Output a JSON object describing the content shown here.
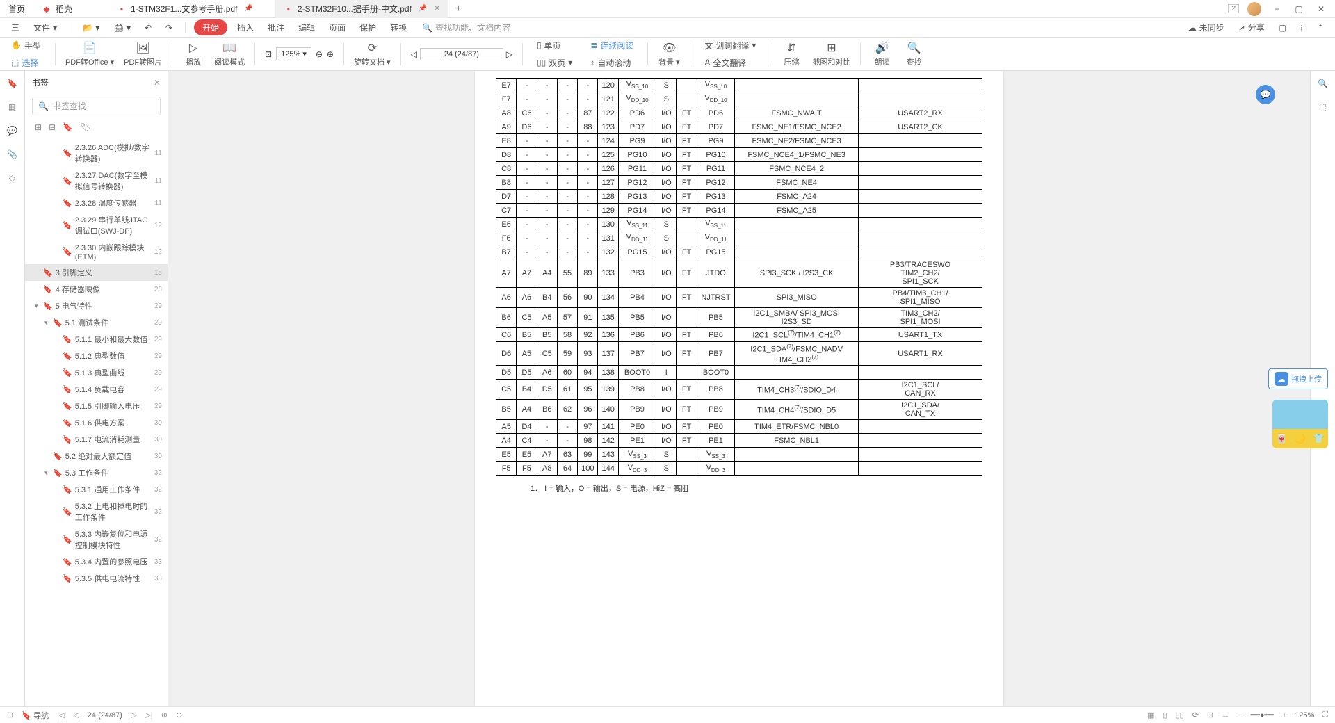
{
  "tabs": {
    "home": "首页",
    "daoke": "稻壳",
    "file1": "1-STM32F1...文参考手册.pdf",
    "file2": "2-STM32F10...据手册-中文.pdf"
  },
  "win": {
    "badge": "2"
  },
  "menubar": {
    "menu": "三",
    "file": "文件",
    "start": "开始",
    "insert": "插入",
    "annotate": "批注",
    "edit": "编辑",
    "page": "页面",
    "protect": "保护",
    "convert": "转换",
    "search_placeholder": "查找功能、文档内容",
    "unsynced": "未同步",
    "share": "分享"
  },
  "ribbon": {
    "hand": "手型",
    "select": "选择",
    "pdf_office": "PDF转Office",
    "pdf_image": "PDF转图片",
    "play": "播放",
    "read_mode": "阅读模式",
    "zoom": "125%",
    "rotate": "旋转文档",
    "page_nav": "24 (24/87)",
    "single": "单页",
    "double": "双页",
    "continuous": "连续阅读",
    "auto_scroll": "自动滚动",
    "background": "背景",
    "word_translate": "划词翻译",
    "full_translate": "全文翻译",
    "compress": "压缩",
    "crop_compare": "截图和对比",
    "read_aloud": "朗读",
    "search": "查找"
  },
  "sidebar": {
    "title": "书签",
    "search_placeholder": "书签查找",
    "items": [
      {
        "indent": 3,
        "text": "2.3.26 ADC(模拟/数字转换器)",
        "page": "11"
      },
      {
        "indent": 3,
        "text": "2.3.27 DAC(数字至模拟信号转换器)",
        "page": "11"
      },
      {
        "indent": 3,
        "text": "2.3.28 温度传感器",
        "page": "11"
      },
      {
        "indent": 3,
        "text": "2.3.29 串行单线JTAG调试口(SWJ-DP)",
        "page": "12"
      },
      {
        "indent": 3,
        "text": "2.3.30 内嵌跟踪模块(ETM)",
        "page": "12"
      },
      {
        "indent": 1,
        "text": "3 引脚定义",
        "page": "15",
        "selected": true
      },
      {
        "indent": 1,
        "text": "4 存储器映像",
        "page": "28"
      },
      {
        "indent": 1,
        "text": "5 电气特性",
        "page": "29",
        "expand": "▾"
      },
      {
        "indent": 2,
        "text": "5.1 测试条件",
        "page": "29",
        "expand": "▾"
      },
      {
        "indent": 3,
        "text": "5.1.1 最小和最大数值",
        "page": "29"
      },
      {
        "indent": 3,
        "text": "5.1.2 典型数值",
        "page": "29"
      },
      {
        "indent": 3,
        "text": "5.1.3 典型曲线",
        "page": "29"
      },
      {
        "indent": 3,
        "text": "5.1.4 负载电容",
        "page": "29"
      },
      {
        "indent": 3,
        "text": "5.1.5 引脚输入电压",
        "page": "29"
      },
      {
        "indent": 3,
        "text": "5.1.6 供电方案",
        "page": "30"
      },
      {
        "indent": 3,
        "text": "5.1.7 电流消耗测量",
        "page": "30"
      },
      {
        "indent": 2,
        "text": "5.2 绝对最大额定值",
        "page": "30"
      },
      {
        "indent": 2,
        "text": "5.3 工作条件",
        "page": "32",
        "expand": "▾"
      },
      {
        "indent": 3,
        "text": "5.3.1 通用工作条件",
        "page": "32"
      },
      {
        "indent": 3,
        "text": "5.3.2 上电和掉电时的工作条件",
        "page": "32"
      },
      {
        "indent": 3,
        "text": "5.3.3 内嵌复位和电源控制模块特性",
        "page": "32"
      },
      {
        "indent": 3,
        "text": "5.3.4 内置的参照电压",
        "page": "33"
      },
      {
        "indent": 3,
        "text": "5.3.5 供电电流特性",
        "page": "33"
      }
    ]
  },
  "doc_note": "1．  I = 输入，O = 输出，S = 电源，HiZ = 高阻",
  "table_rows": [
    [
      "E7",
      "-",
      "-",
      "-",
      "-",
      "120",
      "V<sub>SS_10</sub>",
      "S",
      "",
      "V<sub>SS_10</sub>",
      "",
      ""
    ],
    [
      "F7",
      "-",
      "-",
      "-",
      "-",
      "121",
      "V<sub>DD_10</sub>",
      "S",
      "",
      "V<sub>DD_10</sub>",
      "",
      ""
    ],
    [
      "A8",
      "C6",
      "-",
      "-",
      "87",
      "122",
      "PD6",
      "I/O",
      "FT",
      "PD6",
      "FSMC_NWAIT",
      "USART2_RX"
    ],
    [
      "A9",
      "D6",
      "-",
      "-",
      "88",
      "123",
      "PD7",
      "I/O",
      "FT",
      "PD7",
      "FSMC_NE1/FSMC_NCE2",
      "USART2_CK"
    ],
    [
      "E8",
      "-",
      "-",
      "-",
      "-",
      "124",
      "PG9",
      "I/O",
      "FT",
      "PG9",
      "FSMC_NE2/FSMC_NCE3",
      ""
    ],
    [
      "D8",
      "-",
      "-",
      "-",
      "-",
      "125",
      "PG10",
      "I/O",
      "FT",
      "PG10",
      "FSMC_NCE4_1/FSMC_NE3",
      ""
    ],
    [
      "C8",
      "-",
      "-",
      "-",
      "-",
      "126",
      "PG11",
      "I/O",
      "FT",
      "PG11",
      "FSMC_NCE4_2",
      ""
    ],
    [
      "B8",
      "-",
      "-",
      "-",
      "-",
      "127",
      "PG12",
      "I/O",
      "FT",
      "PG12",
      "FSMC_NE4",
      ""
    ],
    [
      "D7",
      "-",
      "-",
      "-",
      "-",
      "128",
      "PG13",
      "I/O",
      "FT",
      "PG13",
      "FSMC_A24",
      ""
    ],
    [
      "C7",
      "-",
      "-",
      "-",
      "-",
      "129",
      "PG14",
      "I/O",
      "FT",
      "PG14",
      "FSMC_A25",
      ""
    ],
    [
      "E6",
      "-",
      "-",
      "-",
      "-",
      "130",
      "V<sub>SS_11</sub>",
      "S",
      "",
      "V<sub>SS_11</sub>",
      "",
      ""
    ],
    [
      "F6",
      "-",
      "-",
      "-",
      "-",
      "131",
      "V<sub>DD_11</sub>",
      "S",
      "",
      "V<sub>DD_11</sub>",
      "",
      ""
    ],
    [
      "B7",
      "-",
      "-",
      "-",
      "-",
      "132",
      "PG15",
      "I/O",
      "FT",
      "PG15",
      "",
      ""
    ],
    [
      "A7",
      "A7",
      "A4",
      "55",
      "89",
      "133",
      "PB3",
      "I/O",
      "FT",
      "JTDO",
      "SPI3_SCK / I2S3_CK",
      "PB3/TRACESWO<br>TIM2_CH2/<br>SPI1_SCK"
    ],
    [
      "A6",
      "A6",
      "B4",
      "56",
      "90",
      "134",
      "PB4",
      "I/O",
      "FT",
      "NJTRST",
      "SPI3_MISO",
      "PB4/TIM3_CH1/<br>SPI1_MISO"
    ],
    [
      "B6",
      "C5",
      "A5",
      "57",
      "91",
      "135",
      "PB5",
      "I/O",
      "",
      "PB5",
      "I2C1_SMBA/ SPI3_MOSI<br>I2S3_SD",
      "TIM3_CH2/<br>SPI1_MOSI"
    ],
    [
      "C6",
      "B5",
      "B5",
      "58",
      "92",
      "136",
      "PB6",
      "I/O",
      "FT",
      "PB6",
      "I2C1_SCL<sup>(7)</sup>/TIM4_CH1<sup>(7)</sup>",
      "USART1_TX"
    ],
    [
      "D6",
      "A5",
      "C5",
      "59",
      "93",
      "137",
      "PB7",
      "I/O",
      "FT",
      "PB7",
      "I2C1_SDA<sup>(7)</sup>/FSMC_NADV<br>TIM4_CH2<sup>(7)</sup>",
      "USART1_RX"
    ],
    [
      "D5",
      "D5",
      "A6",
      "60",
      "94",
      "138",
      "BOOT0",
      "I",
      "",
      "BOOT0",
      "",
      ""
    ],
    [
      "C5",
      "B4",
      "D5",
      "61",
      "95",
      "139",
      "PB8",
      "I/O",
      "FT",
      "PB8",
      "TIM4_CH3<sup>(7)</sup>/SDIO_D4",
      "I2C1_SCL/<br>CAN_RX"
    ],
    [
      "B5",
      "A4",
      "B6",
      "62",
      "96",
      "140",
      "PB9",
      "I/O",
      "FT",
      "PB9",
      "TIM4_CH4<sup>(7)</sup>/SDIO_D5",
      "I2C1_SDA/<br>CAN_TX"
    ],
    [
      "A5",
      "D4",
      "-",
      "-",
      "97",
      "141",
      "PE0",
      "I/O",
      "FT",
      "PE0",
      "TIM4_ETR/FSMC_NBL0",
      ""
    ],
    [
      "A4",
      "C4",
      "-",
      "-",
      "98",
      "142",
      "PE1",
      "I/O",
      "FT",
      "PE1",
      "FSMC_NBL1",
      ""
    ],
    [
      "E5",
      "E5",
      "A7",
      "63",
      "99",
      "143",
      "V<sub>SS_3</sub>",
      "S",
      "",
      "V<sub>SS_3</sub>",
      "",
      ""
    ],
    [
      "F5",
      "F5",
      "A8",
      "64",
      "100",
      "144",
      "V<sub>DD_3</sub>",
      "S",
      "",
      "V<sub>DD_3</sub>",
      "",
      ""
    ]
  ],
  "float": {
    "upload": "拖拽上传"
  },
  "statusbar": {
    "nav": "导航",
    "page": "24 (24/87)",
    "zoom": "125%"
  }
}
